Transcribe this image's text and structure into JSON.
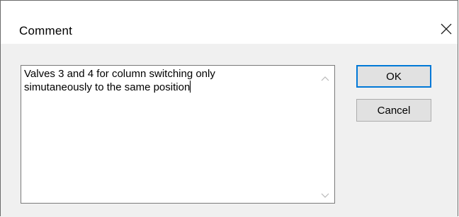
{
  "window": {
    "title": "Comment"
  },
  "comment": {
    "line1": "Valves 3 and 4 for column switching only",
    "line2": "simutaneously to the same position"
  },
  "buttons": {
    "ok_label": "OK",
    "cancel_label": "Cancel"
  },
  "icons": {
    "close": "close-icon",
    "scroll_up": "chevron-up-icon",
    "scroll_down": "chevron-down-icon"
  },
  "colors": {
    "accent": "#0078d7",
    "dialog_bg": "#f0f0f0",
    "button_bg": "#e1e1e1"
  }
}
